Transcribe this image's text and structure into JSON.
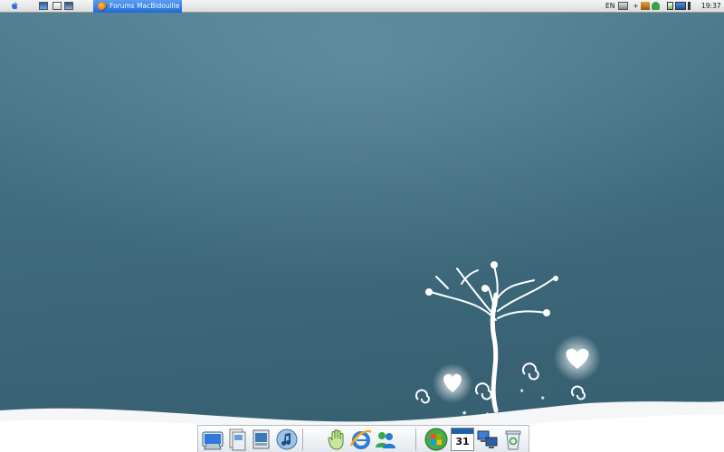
{
  "menubar": {
    "apple_icon": "apple-logo-icon",
    "quick_launch": [
      "finder-window-icon",
      "document-icon",
      "screenshot-icon"
    ],
    "task_button_label": "Forums MacBidouille ...",
    "task_button_icon": "firefox-icon",
    "input_language": "EN",
    "tray_icons": [
      "printer-icon",
      "plus-icon",
      "network-icon",
      "user-icon",
      "battery-icon",
      "monitor-icon",
      "volume-icon"
    ],
    "clock": "19:37"
  },
  "dock": {
    "items": [
      {
        "name": "finder",
        "icon": "finder-icon"
      },
      {
        "name": "preview",
        "icon": "preview-icon"
      },
      {
        "name": "photo-viewer",
        "icon": "photo-viewer-icon"
      },
      {
        "name": "itunes",
        "icon": "itunes-icon"
      },
      {
        "name": "hand-tool",
        "icon": "hand-icon"
      },
      {
        "name": "internet-explorer",
        "icon": "internet-explorer-icon"
      },
      {
        "name": "messenger",
        "icon": "messenger-icon"
      },
      {
        "name": "windows-start",
        "icon": "windows-logo-icon"
      },
      {
        "name": "calendar",
        "icon": "calendar-icon",
        "label": "31"
      },
      {
        "name": "network",
        "icon": "network-computers-icon"
      },
      {
        "name": "recycle-bin",
        "icon": "recycle-bin-icon"
      }
    ]
  },
  "colors": {
    "wallpaper": "#3f6a7c",
    "task_button": "#1f6ad9",
    "snow": "#ffffff"
  }
}
